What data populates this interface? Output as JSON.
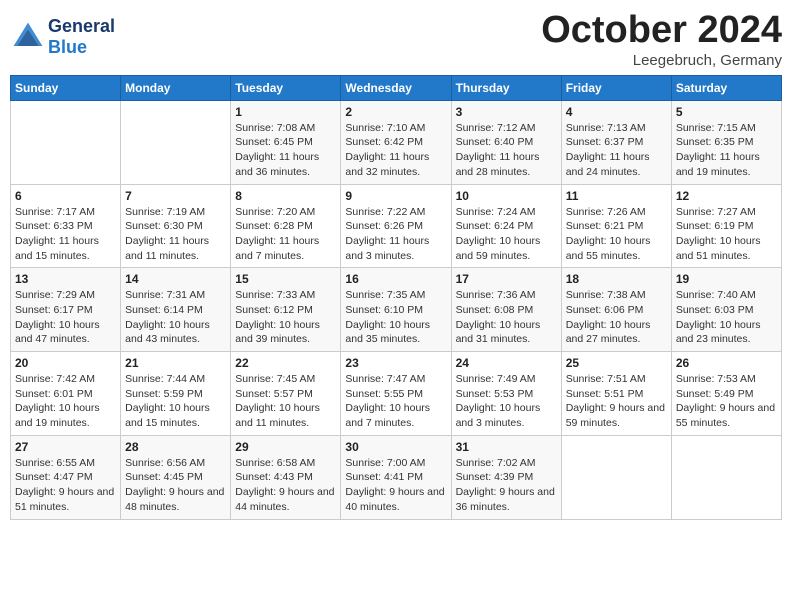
{
  "header": {
    "logo_general": "General",
    "logo_blue": "Blue",
    "month": "October 2024",
    "location": "Leegebruch, Germany"
  },
  "weekdays": [
    "Sunday",
    "Monday",
    "Tuesday",
    "Wednesday",
    "Thursday",
    "Friday",
    "Saturday"
  ],
  "weeks": [
    [
      {
        "num": "",
        "sunrise": "",
        "sunset": "",
        "daylight": ""
      },
      {
        "num": "",
        "sunrise": "",
        "sunset": "",
        "daylight": ""
      },
      {
        "num": "1",
        "sunrise": "Sunrise: 7:08 AM",
        "sunset": "Sunset: 6:45 PM",
        "daylight": "Daylight: 11 hours and 36 minutes."
      },
      {
        "num": "2",
        "sunrise": "Sunrise: 7:10 AM",
        "sunset": "Sunset: 6:42 PM",
        "daylight": "Daylight: 11 hours and 32 minutes."
      },
      {
        "num": "3",
        "sunrise": "Sunrise: 7:12 AM",
        "sunset": "Sunset: 6:40 PM",
        "daylight": "Daylight: 11 hours and 28 minutes."
      },
      {
        "num": "4",
        "sunrise": "Sunrise: 7:13 AM",
        "sunset": "Sunset: 6:37 PM",
        "daylight": "Daylight: 11 hours and 24 minutes."
      },
      {
        "num": "5",
        "sunrise": "Sunrise: 7:15 AM",
        "sunset": "Sunset: 6:35 PM",
        "daylight": "Daylight: 11 hours and 19 minutes."
      }
    ],
    [
      {
        "num": "6",
        "sunrise": "Sunrise: 7:17 AM",
        "sunset": "Sunset: 6:33 PM",
        "daylight": "Daylight: 11 hours and 15 minutes."
      },
      {
        "num": "7",
        "sunrise": "Sunrise: 7:19 AM",
        "sunset": "Sunset: 6:30 PM",
        "daylight": "Daylight: 11 hours and 11 minutes."
      },
      {
        "num": "8",
        "sunrise": "Sunrise: 7:20 AM",
        "sunset": "Sunset: 6:28 PM",
        "daylight": "Daylight: 11 hours and 7 minutes."
      },
      {
        "num": "9",
        "sunrise": "Sunrise: 7:22 AM",
        "sunset": "Sunset: 6:26 PM",
        "daylight": "Daylight: 11 hours and 3 minutes."
      },
      {
        "num": "10",
        "sunrise": "Sunrise: 7:24 AM",
        "sunset": "Sunset: 6:24 PM",
        "daylight": "Daylight: 10 hours and 59 minutes."
      },
      {
        "num": "11",
        "sunrise": "Sunrise: 7:26 AM",
        "sunset": "Sunset: 6:21 PM",
        "daylight": "Daylight: 10 hours and 55 minutes."
      },
      {
        "num": "12",
        "sunrise": "Sunrise: 7:27 AM",
        "sunset": "Sunset: 6:19 PM",
        "daylight": "Daylight: 10 hours and 51 minutes."
      }
    ],
    [
      {
        "num": "13",
        "sunrise": "Sunrise: 7:29 AM",
        "sunset": "Sunset: 6:17 PM",
        "daylight": "Daylight: 10 hours and 47 minutes."
      },
      {
        "num": "14",
        "sunrise": "Sunrise: 7:31 AM",
        "sunset": "Sunset: 6:14 PM",
        "daylight": "Daylight: 10 hours and 43 minutes."
      },
      {
        "num": "15",
        "sunrise": "Sunrise: 7:33 AM",
        "sunset": "Sunset: 6:12 PM",
        "daylight": "Daylight: 10 hours and 39 minutes."
      },
      {
        "num": "16",
        "sunrise": "Sunrise: 7:35 AM",
        "sunset": "Sunset: 6:10 PM",
        "daylight": "Daylight: 10 hours and 35 minutes."
      },
      {
        "num": "17",
        "sunrise": "Sunrise: 7:36 AM",
        "sunset": "Sunset: 6:08 PM",
        "daylight": "Daylight: 10 hours and 31 minutes."
      },
      {
        "num": "18",
        "sunrise": "Sunrise: 7:38 AM",
        "sunset": "Sunset: 6:06 PM",
        "daylight": "Daylight: 10 hours and 27 minutes."
      },
      {
        "num": "19",
        "sunrise": "Sunrise: 7:40 AM",
        "sunset": "Sunset: 6:03 PM",
        "daylight": "Daylight: 10 hours and 23 minutes."
      }
    ],
    [
      {
        "num": "20",
        "sunrise": "Sunrise: 7:42 AM",
        "sunset": "Sunset: 6:01 PM",
        "daylight": "Daylight: 10 hours and 19 minutes."
      },
      {
        "num": "21",
        "sunrise": "Sunrise: 7:44 AM",
        "sunset": "Sunset: 5:59 PM",
        "daylight": "Daylight: 10 hours and 15 minutes."
      },
      {
        "num": "22",
        "sunrise": "Sunrise: 7:45 AM",
        "sunset": "Sunset: 5:57 PM",
        "daylight": "Daylight: 10 hours and 11 minutes."
      },
      {
        "num": "23",
        "sunrise": "Sunrise: 7:47 AM",
        "sunset": "Sunset: 5:55 PM",
        "daylight": "Daylight: 10 hours and 7 minutes."
      },
      {
        "num": "24",
        "sunrise": "Sunrise: 7:49 AM",
        "sunset": "Sunset: 5:53 PM",
        "daylight": "Daylight: 10 hours and 3 minutes."
      },
      {
        "num": "25",
        "sunrise": "Sunrise: 7:51 AM",
        "sunset": "Sunset: 5:51 PM",
        "daylight": "Daylight: 9 hours and 59 minutes."
      },
      {
        "num": "26",
        "sunrise": "Sunrise: 7:53 AM",
        "sunset": "Sunset: 5:49 PM",
        "daylight": "Daylight: 9 hours and 55 minutes."
      }
    ],
    [
      {
        "num": "27",
        "sunrise": "Sunrise: 6:55 AM",
        "sunset": "Sunset: 4:47 PM",
        "daylight": "Daylight: 9 hours and 51 minutes."
      },
      {
        "num": "28",
        "sunrise": "Sunrise: 6:56 AM",
        "sunset": "Sunset: 4:45 PM",
        "daylight": "Daylight: 9 hours and 48 minutes."
      },
      {
        "num": "29",
        "sunrise": "Sunrise: 6:58 AM",
        "sunset": "Sunset: 4:43 PM",
        "daylight": "Daylight: 9 hours and 44 minutes."
      },
      {
        "num": "30",
        "sunrise": "Sunrise: 7:00 AM",
        "sunset": "Sunset: 4:41 PM",
        "daylight": "Daylight: 9 hours and 40 minutes."
      },
      {
        "num": "31",
        "sunrise": "Sunrise: 7:02 AM",
        "sunset": "Sunset: 4:39 PM",
        "daylight": "Daylight: 9 hours and 36 minutes."
      },
      {
        "num": "",
        "sunrise": "",
        "sunset": "",
        "daylight": ""
      },
      {
        "num": "",
        "sunrise": "",
        "sunset": "",
        "daylight": ""
      }
    ]
  ]
}
